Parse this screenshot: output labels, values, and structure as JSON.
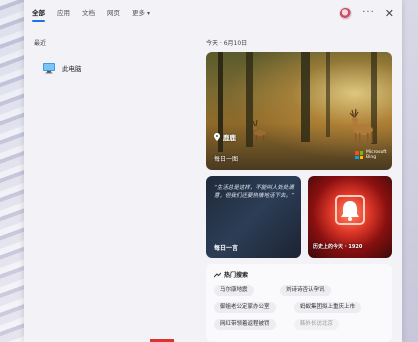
{
  "tabs": [
    {
      "label": "全部",
      "active": true
    },
    {
      "label": "应用",
      "active": false
    },
    {
      "label": "文档",
      "active": false
    },
    {
      "label": "网页",
      "active": false
    },
    {
      "label": "更多",
      "active": false,
      "has_dropdown": true
    }
  ],
  "top_right": {
    "more_glyph": "···",
    "close_glyph": "✕"
  },
  "recent": {
    "label": "最近",
    "items": [
      {
        "label": "此电脑",
        "icon": "computer-icon"
      }
    ]
  },
  "date_label": "今天 · 6月10日",
  "daily_card": {
    "badge": "鹿鹿",
    "caption": "每日一图",
    "brand": "Microsoft Bing"
  },
  "quote_card": {
    "text": "“生活总是这样，不能叫人处处满意，但我们还要热情地活下去。”",
    "caption": "每日一言"
  },
  "history_card": {
    "caption": "历史上的今天 · 1920"
  },
  "hot_search": {
    "title": "热门搜索",
    "chips": [
      {
        "label": "马尔康地震",
        "faded": false
      },
      {
        "label": "刘诗诗否认孕讯",
        "faded": false
      },
      {
        "label": "御姐老公定家办公室",
        "faded": false
      },
      {
        "label": "蚂蚁集团拟上重庆上市",
        "faded": false
      },
      {
        "label": "网红带领着返程被罚",
        "faded": false
      },
      {
        "label": "韩外长访北京",
        "faded": true
      }
    ]
  },
  "colors": {
    "accent": "#1a73e8",
    "panel": "#f3f3f7"
  }
}
